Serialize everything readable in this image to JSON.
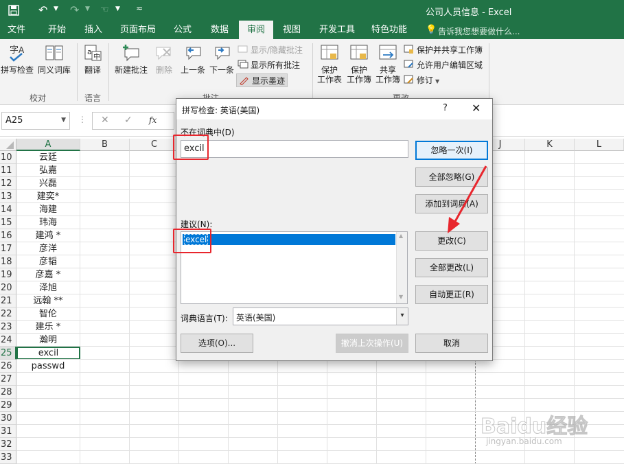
{
  "window": {
    "title": "公司人员信息 - Excel"
  },
  "ribbon_tabs": [
    "文件",
    "开始",
    "插入",
    "页面布局",
    "公式",
    "数据",
    "审阅",
    "视图",
    "开发工具",
    "特色功能"
  ],
  "tell_me": "告诉我您想要做什么...",
  "ribbon": {
    "spelling": "拼写检查",
    "thesaurus": "同义词库",
    "translate": "翻译",
    "new_comment": "新建批注",
    "delete": "删除",
    "previous": "上一条",
    "next": "下一条",
    "show_hide_comment": "显示/隐藏批注",
    "show_all_comments": "显示所有批注",
    "show_ink": "显示墨迹",
    "protect_sheet": [
      "保护",
      "工作表"
    ],
    "protect_workbook": [
      "保护",
      "工作簿"
    ],
    "share_workbook": [
      "共享",
      "工作簿"
    ],
    "protect_share": "保护并共享工作簿",
    "allow_edit_ranges": "允许用户编辑区域",
    "track_changes": "修订",
    "group_proofing": "校对",
    "group_language": "语言",
    "group_comments": "批注",
    "group_changes": "更改"
  },
  "formula_bar": {
    "name_box": "A25",
    "fx": "fx"
  },
  "columns": [
    "A",
    "B",
    "C",
    "J",
    "K",
    "L"
  ],
  "rows": [
    {
      "n": "10",
      "a": "云廷"
    },
    {
      "n": "11",
      "a": "弘嘉"
    },
    {
      "n": "12",
      "a": "兴磊"
    },
    {
      "n": "13",
      "a": "建奕*"
    },
    {
      "n": "14",
      "a": "海建"
    },
    {
      "n": "15",
      "a": "玮海"
    },
    {
      "n": "16",
      "a": "建鸿 *"
    },
    {
      "n": "17",
      "a": "彦洋"
    },
    {
      "n": "18",
      "a": "彦韬"
    },
    {
      "n": "19",
      "a": "彦嘉 *"
    },
    {
      "n": "20",
      "a": "泽旭"
    },
    {
      "n": "21",
      "a": "远翰 **"
    },
    {
      "n": "22",
      "a": "智伦"
    },
    {
      "n": "23",
      "a": "建乐 *"
    },
    {
      "n": "24",
      "a": "瀚明"
    },
    {
      "n": "25",
      "a": "excil"
    },
    {
      "n": "26",
      "a": "passwd"
    },
    {
      "n": "27",
      "a": ""
    },
    {
      "n": "28",
      "a": ""
    },
    {
      "n": "29",
      "a": ""
    },
    {
      "n": "30",
      "a": ""
    },
    {
      "n": "31",
      "a": ""
    },
    {
      "n": "32",
      "a": ""
    },
    {
      "n": "33",
      "a": ""
    }
  ],
  "dialog": {
    "title": "拼写检查: 英语(美国)",
    "help": "?",
    "not_in_dict_label": "不在词典中(D)",
    "not_in_dict_value": "excil",
    "suggestions_label": "建议(N):",
    "suggestions": [
      "excel"
    ],
    "dict_lang_label": "词典语言(T):",
    "dict_lang_value": "英语(美国)",
    "ignore_once": "忽略一次(I)",
    "ignore_all": "全部忽略(G)",
    "add_to_dict": "添加到词典(A)",
    "change": "更改(C)",
    "change_all": "全部更改(L)",
    "autocorrect": "自动更正(R)",
    "options": "选项(O)...",
    "undo_last": "撤消上次操作(U)",
    "cancel": "取消"
  },
  "watermark": {
    "brand": "Baidu经验",
    "url": "jingyan.baidu.com"
  },
  "colors": {
    "excel_green": "#217346",
    "highlight_red": "#e8262d",
    "selection_blue": "#0078d7"
  }
}
